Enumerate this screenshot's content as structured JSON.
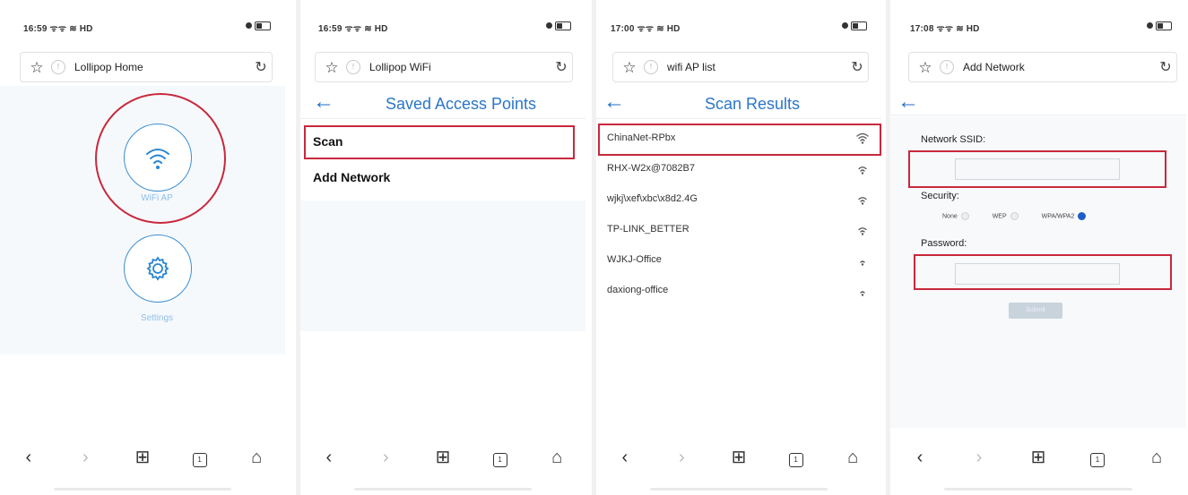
{
  "screens": [
    {
      "status_time": "16:59 ᯤᯤ ≋ HD",
      "address_title": "Lollipop Home",
      "tiles": [
        {
          "label": "WiFi AP",
          "icon": "wifi-icon"
        },
        {
          "label": "Settings",
          "icon": "gear-icon"
        }
      ]
    },
    {
      "status_time": "16:59 ᯤᯤ ≋ HD",
      "address_title": "Lollipop WiFi",
      "header_title": "Saved Access Points",
      "menu": [
        "Scan",
        "Add Network"
      ]
    },
    {
      "status_time": "17:00 ᯤᯤ ≋ HD",
      "address_title": "wifi AP list",
      "header_title": "Scan Results",
      "networks": [
        {
          "name": "ChinaNet-RPbx",
          "signal": 4
        },
        {
          "name": "RHX-W2x@7082B7",
          "signal": 3
        },
        {
          "name": "wjkj\\xef\\xbc\\x8d2.4G",
          "signal": 3
        },
        {
          "name": "TP-LINK_BETTER",
          "signal": 3
        },
        {
          "name": "WJKJ-Office",
          "signal": 2
        },
        {
          "name": "daxiong-office",
          "signal": 2
        }
      ]
    },
    {
      "status_time": "17:08 ᯤᯤ ≋ HD",
      "address_title": "Add Network",
      "form": {
        "ssid_label": "Network SSID:",
        "ssid_value": "",
        "security_label": "Security:",
        "security_options": [
          "None",
          "WEP",
          "WPA/WPA2"
        ],
        "security_selected": "WPA/WPA2",
        "password_label": "Password:",
        "password_value": "",
        "submit_label": "Submit"
      }
    }
  ],
  "nav": {
    "back": "‹",
    "forward": "›",
    "apps": "⊞",
    "tabs": "1",
    "home": "⌂"
  },
  "icons": {
    "star": "☆",
    "reload": "↻",
    "back_arrow": "←",
    "shield": "!"
  },
  "colors": {
    "accent": "#2a76c8",
    "highlight": "#c8283c",
    "selected_radio": "#1e5ec6"
  }
}
